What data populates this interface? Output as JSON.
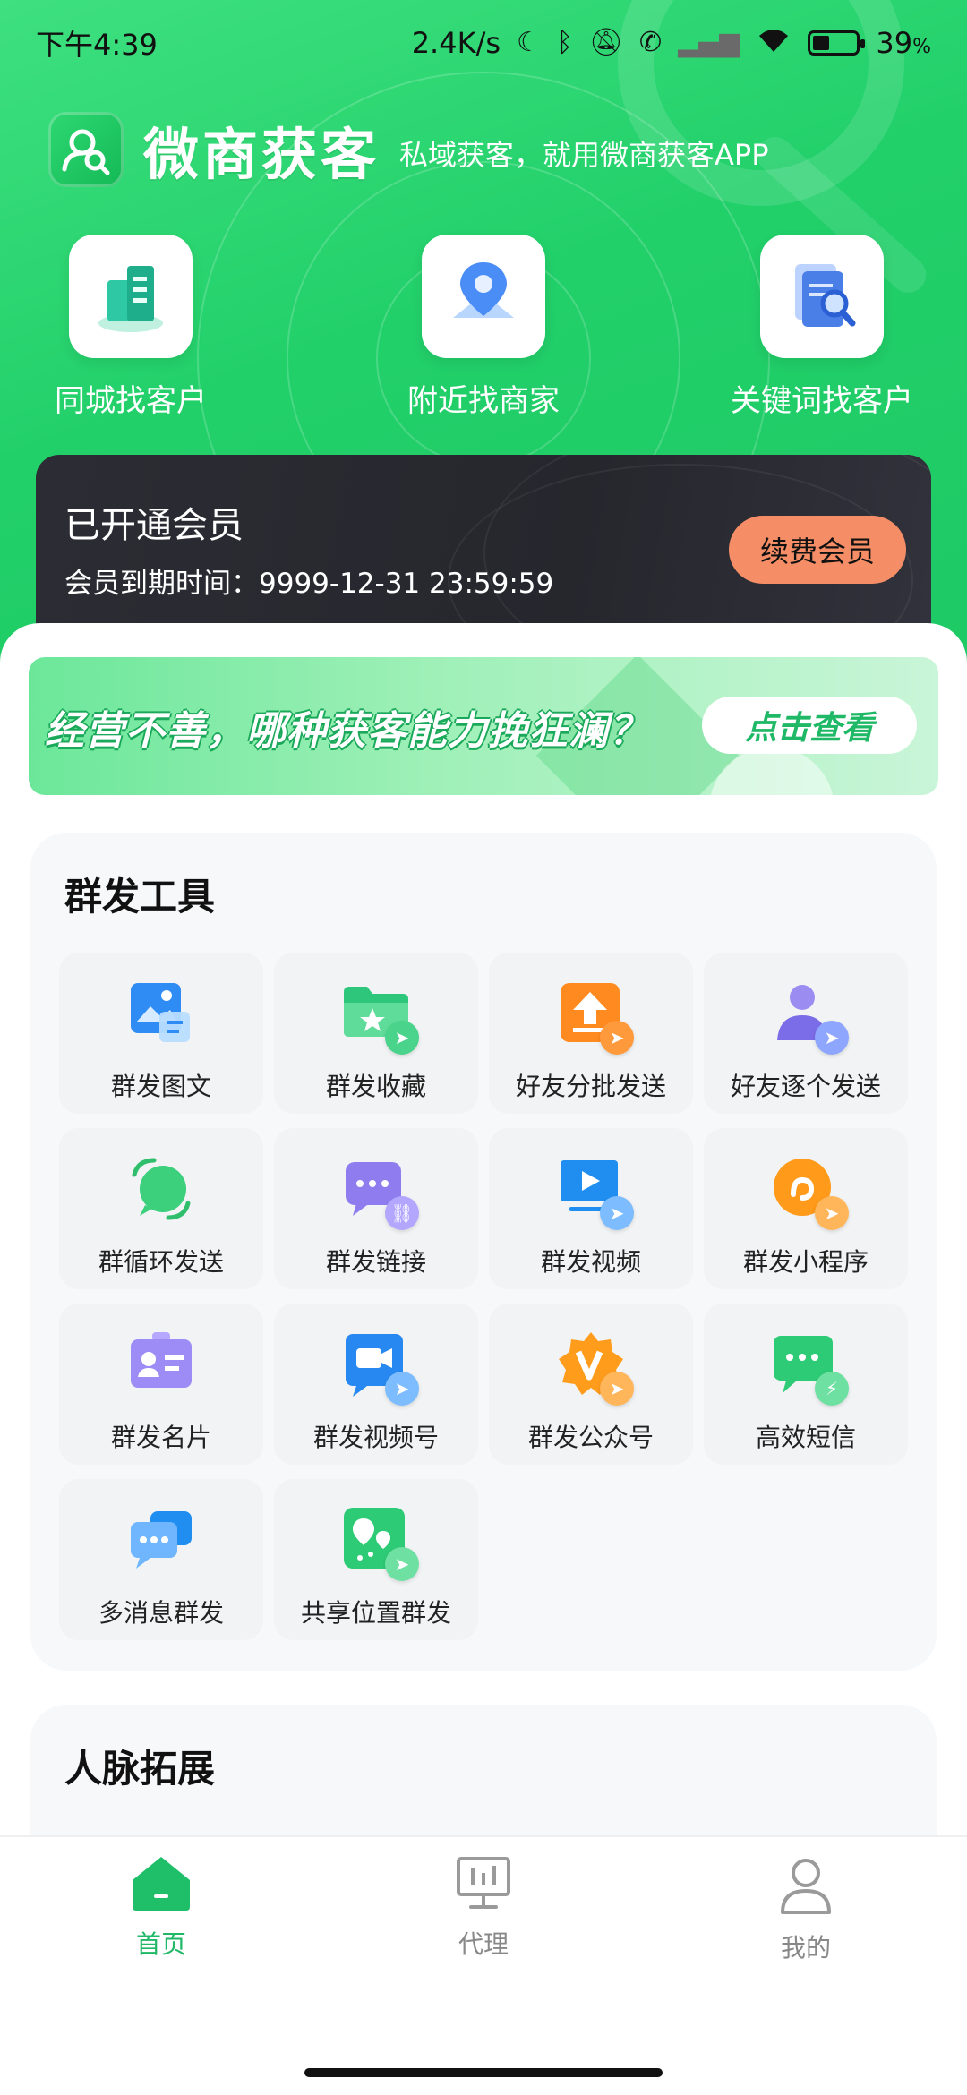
{
  "status_bar": {
    "time": "下午4:39",
    "speed": "2.4K/s",
    "battery": "39",
    "battery_unit": "%"
  },
  "brand": {
    "name": "微商获客",
    "slogan": "私域获客，就用微商获客APP"
  },
  "quick_actions": [
    {
      "label": "同城找客户",
      "icon": "building-icon"
    },
    {
      "label": "附近找商家",
      "icon": "map-pin-icon"
    },
    {
      "label": "关键词找客户",
      "icon": "document-search-icon"
    }
  ],
  "membership": {
    "title": "已开通会员",
    "expire": "会员到期时间：9999-12-31 23:59:59",
    "renew_label": "续费会员"
  },
  "banner": {
    "headline": "经营不善，哪种获客能力挽狂澜？",
    "cta": "点击查看"
  },
  "tools": {
    "title": "群发工具",
    "items": [
      {
        "label": "群发图文",
        "icon": "image-text-icon"
      },
      {
        "label": "群发收藏",
        "icon": "folder-star-icon"
      },
      {
        "label": "好友分批发送",
        "icon": "upload-batch-icon"
      },
      {
        "label": "好友逐个发送",
        "icon": "user-send-icon"
      },
      {
        "label": "群循环发送",
        "icon": "chat-loop-icon"
      },
      {
        "label": "群发链接",
        "icon": "chat-link-icon"
      },
      {
        "label": "群发视频",
        "icon": "video-play-icon"
      },
      {
        "label": "群发小程序",
        "icon": "mini-program-icon"
      },
      {
        "label": "群发名片",
        "icon": "business-card-icon"
      },
      {
        "label": "群发视频号",
        "icon": "video-channel-icon"
      },
      {
        "label": "群发公众号",
        "icon": "official-account-icon"
      },
      {
        "label": "高效短信",
        "icon": "sms-flash-icon"
      },
      {
        "label": "多消息群发",
        "icon": "multi-message-icon"
      },
      {
        "label": "共享位置群发",
        "icon": "shared-location-icon"
      }
    ]
  },
  "network": {
    "title": "人脉拓展"
  },
  "tabbar": [
    {
      "label": "首页",
      "icon": "home-icon",
      "active": true
    },
    {
      "label": "代理",
      "icon": "agent-board-icon",
      "active": false
    },
    {
      "label": "我的",
      "icon": "profile-icon",
      "active": false
    }
  ],
  "colors": {
    "brand_green": "#22d06a",
    "active_tab": "#1fb866",
    "renew_button": "#f58e66",
    "member_card": "#26262d"
  }
}
